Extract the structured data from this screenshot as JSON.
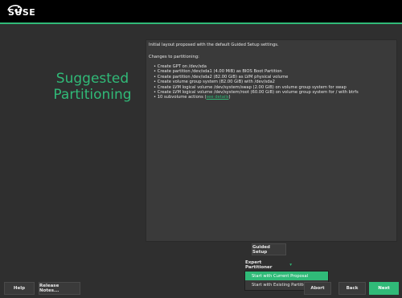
{
  "header": {
    "logo_text": "SUSE",
    "logo_icon": "chameleon-logo-icon"
  },
  "title": {
    "line1": "Suggested",
    "line2": "Partitioning"
  },
  "proposal": {
    "intro": "Initial layout proposed with the default Guided Setup settings.",
    "changes_label": "Changes to partitioning:",
    "items": [
      "Create GPT on /dev/sda",
      "Create partition /dev/sda1 (4.00 MiB) as BIOS Boot Partition",
      "Create partition /dev/sda2 (82.00 GiB) as LVM physical volume",
      "Create volume group system (82.00 GiB) with /dev/sda2",
      "Create LVM logical volume /dev/system/swap (2.00 GiB) on volume group system for swap",
      "Create LVM logical volume /dev/system/root (60.00 GiB) on volume group system for / with btrfs"
    ],
    "last_item_prefix": "10 subvolume actions (",
    "last_item_link": "see details",
    "last_item_suffix": ")"
  },
  "buttons": {
    "guided_setup": "Guided Setup",
    "expert_partitioner": "Expert Partitioner",
    "expert_arrow": "▾",
    "help": "Help",
    "release_notes": "Release Notes...",
    "abort": "Abort",
    "back": "Back",
    "next": "Next"
  },
  "expert_menu": {
    "items": [
      "Start with Current Proposal",
      "Start with Existing Partitions"
    ],
    "selected_index": 0
  },
  "colors": {
    "accent": "#30ba78",
    "background": "#2f2f2f",
    "topbar": "#000000"
  }
}
